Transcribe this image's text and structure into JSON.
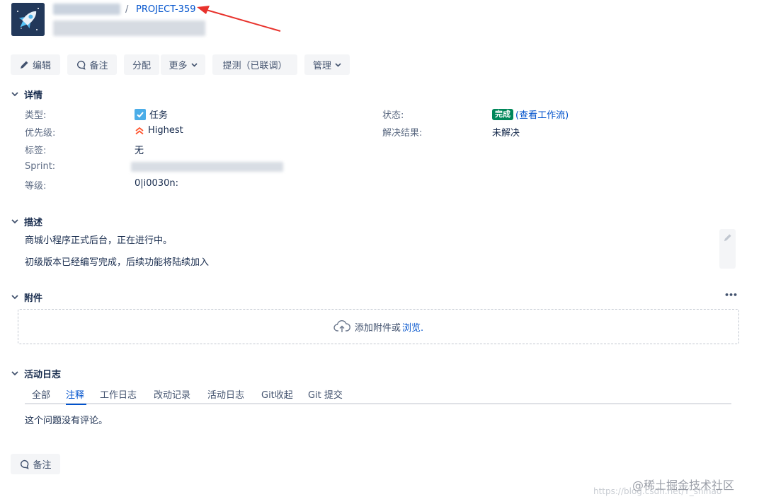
{
  "header": {
    "separator": "/",
    "issue_key": "PROJECT-359"
  },
  "toolbar": {
    "edit": "编辑",
    "comment": "备注",
    "assign": "分配",
    "more": "更多",
    "test": "提测（已联调）",
    "admin": "管理"
  },
  "details": {
    "title": "详情",
    "type_label": "类型:",
    "type_value": "任务",
    "priority_label": "优先级:",
    "priority_value": "Highest",
    "labels_label": "标签:",
    "labels_value": "无",
    "sprint_label": "Sprint:",
    "rank_label": "等级:",
    "rank_value": "0|i0030n:",
    "status_label": "状态:",
    "status_value": "完成",
    "status_link": "(查看工作流)",
    "resolution_label": "解决结果:",
    "resolution_value": "未解决"
  },
  "description": {
    "title": "描述",
    "line1": "商城小程序正式后台，正在进行中。",
    "line2": "初级版本已经编写完成，后续功能将陆续加入"
  },
  "attachments": {
    "title": "附件",
    "more": "•••",
    "drop_text": "添加附件或",
    "browse": "浏览."
  },
  "activity": {
    "title": "活动日志",
    "tabs": [
      "全部",
      "注释",
      "工作日志",
      "改动记录",
      "活动日志",
      "Git收起",
      "Git 提交"
    ],
    "active_tab": 1,
    "empty": "这个问题没有评论。",
    "comment_button": "备注"
  },
  "watermark": {
    "brand": "@稀土掘金技术社区",
    "url": "https://blog.csdn.net/Y_shihao"
  },
  "colors": {
    "accent": "#0052cc",
    "done": "#00875a",
    "priority": "#ff5630",
    "arrow": "#e8322c"
  }
}
